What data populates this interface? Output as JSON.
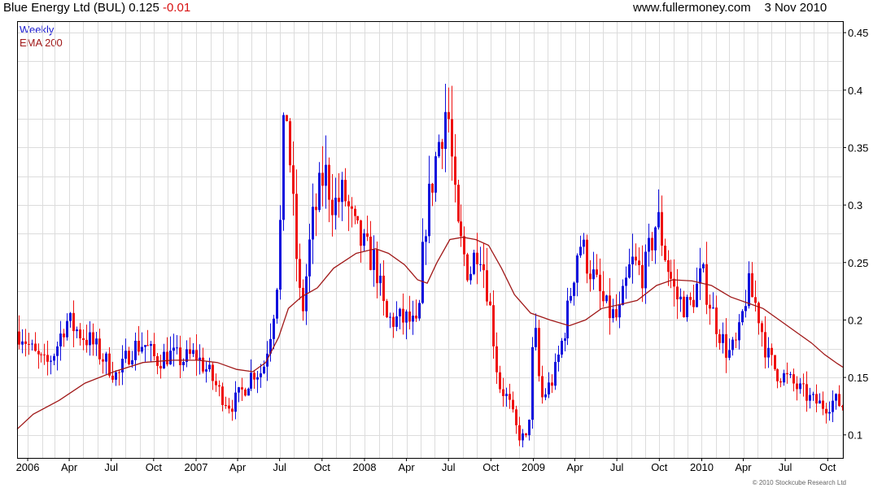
{
  "header": {
    "company": "Blue Energy Ltd (BUL)",
    "price": "0.125",
    "change": "-0.01",
    "site": "www.fullermoney.com",
    "date": "3 Nov 2010"
  },
  "legend": {
    "weekly_label": "Weekly",
    "ema_label": "EMA 200"
  },
  "copyright": "© 2010 Stockcube Research Ltd",
  "colors": {
    "up": "#1010dd",
    "down": "#ee1010",
    "ema": "#a01818",
    "grid": "#dcdcdc",
    "axis": "#000000"
  },
  "chart_data": {
    "type": "candlestick",
    "interval": "weekly",
    "ylim": [
      0.08,
      0.46
    ],
    "y_ticks": [
      "0.1",
      "0.15",
      "0.2",
      "0.25",
      "0.3",
      "0.35",
      "0.4",
      "0.45"
    ],
    "x_ticks": [
      "2006",
      "Apr",
      "Jul",
      "Oct",
      "2007",
      "Apr",
      "Jul",
      "Oct",
      "2008",
      "Apr",
      "Jul",
      "Oct",
      "2009",
      "Apr",
      "Jul",
      "Oct",
      "2010",
      "Apr",
      "Jul",
      "Oct"
    ],
    "grid": true,
    "x_start": "2005-12-09",
    "x_end": "2010-11-03",
    "close_path": [
      [
        "2005-12-16",
        0.19
      ],
      [
        "2006-01-13",
        0.17
      ],
      [
        "2006-02-10",
        0.16
      ],
      [
        "2006-03-03",
        0.175
      ],
      [
        "2006-03-24",
        0.2
      ],
      [
        "2006-04-21",
        0.19
      ],
      [
        "2006-05-19",
        0.18
      ],
      [
        "2006-06-16",
        0.165
      ],
      [
        "2006-07-14",
        0.15
      ],
      [
        "2006-08-11",
        0.175
      ],
      [
        "2006-09-08",
        0.18
      ],
      [
        "2006-10-06",
        0.165
      ],
      [
        "2006-11-03",
        0.17
      ],
      [
        "2006-12-01",
        0.165
      ],
      [
        "2006-12-29",
        0.17
      ],
      [
        "2007-01-26",
        0.155
      ],
      [
        "2007-02-23",
        0.135
      ],
      [
        "2007-03-16",
        0.125
      ],
      [
        "2007-04-13",
        0.14
      ],
      [
        "2007-05-04",
        0.155
      ],
      [
        "2007-05-25",
        0.155
      ],
      [
        "2007-06-15",
        0.2
      ],
      [
        "2007-06-29",
        0.25
      ],
      [
        "2007-07-13",
        0.4
      ],
      [
        "2007-08-03",
        0.27
      ],
      [
        "2007-08-17",
        0.2
      ],
      [
        "2007-09-07",
        0.28
      ],
      [
        "2007-10-05",
        0.33
      ],
      [
        "2007-10-26",
        0.3
      ],
      [
        "2007-11-16",
        0.31
      ],
      [
        "2007-12-07",
        0.28
      ],
      [
        "2008-01-04",
        0.26
      ],
      [
        "2008-01-25",
        0.25
      ],
      [
        "2008-02-15",
        0.2
      ],
      [
        "2008-03-14",
        0.2
      ],
      [
        "2008-04-04",
        0.2
      ],
      [
        "2008-04-25",
        0.19
      ],
      [
        "2008-05-09",
        0.28
      ],
      [
        "2008-06-06",
        0.35
      ],
      [
        "2008-06-27",
        0.39
      ],
      [
        "2008-07-18",
        0.28
      ],
      [
        "2008-08-15",
        0.24
      ],
      [
        "2008-09-05",
        0.27
      ],
      [
        "2008-09-26",
        0.22
      ],
      [
        "2008-10-17",
        0.145
      ],
      [
        "2008-11-07",
        0.13
      ],
      [
        "2008-11-28",
        0.1
      ],
      [
        "2008-12-19",
        0.095
      ],
      [
        "2009-01-02",
        0.2
      ],
      [
        "2009-01-16",
        0.13
      ],
      [
        "2009-02-13",
        0.15
      ],
      [
        "2009-03-13",
        0.2
      ],
      [
        "2009-04-10",
        0.27
      ],
      [
        "2009-05-08",
        0.24
      ],
      [
        "2009-06-05",
        0.21
      ],
      [
        "2009-07-03",
        0.2
      ],
      [
        "2009-07-31",
        0.25
      ],
      [
        "2009-08-28",
        0.24
      ],
      [
        "2009-09-25",
        0.29
      ],
      [
        "2009-10-16",
        0.25
      ],
      [
        "2009-11-06",
        0.22
      ],
      [
        "2009-12-04",
        0.21
      ],
      [
        "2010-01-01",
        0.24
      ],
      [
        "2010-01-29",
        0.2
      ],
      [
        "2010-02-26",
        0.17
      ],
      [
        "2010-03-19",
        0.18
      ],
      [
        "2010-04-09",
        0.23
      ],
      [
        "2010-04-30",
        0.21
      ],
      [
        "2010-05-21",
        0.17
      ],
      [
        "2010-06-11",
        0.155
      ],
      [
        "2010-07-02",
        0.15
      ],
      [
        "2010-07-30",
        0.14
      ],
      [
        "2010-08-27",
        0.13
      ],
      [
        "2010-09-24",
        0.125
      ],
      [
        "2010-10-15",
        0.13
      ],
      [
        "2010-11-03",
        0.125
      ]
    ],
    "ema200": [
      [
        "2005-12-09",
        0.105
      ],
      [
        "2006-01-13",
        0.118
      ],
      [
        "2006-03-10",
        0.13
      ],
      [
        "2006-05-05",
        0.145
      ],
      [
        "2006-07-07",
        0.155
      ],
      [
        "2006-09-08",
        0.163
      ],
      [
        "2006-11-10",
        0.165
      ],
      [
        "2007-01-05",
        0.165
      ],
      [
        "2007-02-16",
        0.163
      ],
      [
        "2007-03-30",
        0.157
      ],
      [
        "2007-05-04",
        0.155
      ],
      [
        "2007-06-01",
        0.163
      ],
      [
        "2007-06-29",
        0.185
      ],
      [
        "2007-07-20",
        0.21
      ],
      [
        "2007-08-17",
        0.22
      ],
      [
        "2007-09-21",
        0.228
      ],
      [
        "2007-10-26",
        0.245
      ],
      [
        "2007-12-14",
        0.258
      ],
      [
        "2008-01-25",
        0.262
      ],
      [
        "2008-02-22",
        0.258
      ],
      [
        "2008-03-28",
        0.248
      ],
      [
        "2008-04-25",
        0.235
      ],
      [
        "2008-05-16",
        0.232
      ],
      [
        "2008-06-06",
        0.25
      ],
      [
        "2008-07-04",
        0.27
      ],
      [
        "2008-08-01",
        0.272
      ],
      [
        "2008-08-29",
        0.27
      ],
      [
        "2008-09-26",
        0.265
      ],
      [
        "2008-10-24",
        0.245
      ],
      [
        "2008-11-21",
        0.222
      ],
      [
        "2008-12-26",
        0.206
      ],
      [
        "2009-02-06",
        0.2
      ],
      [
        "2009-03-20",
        0.195
      ],
      [
        "2009-04-24",
        0.2
      ],
      [
        "2009-05-29",
        0.21
      ],
      [
        "2009-07-03",
        0.213
      ],
      [
        "2009-08-14",
        0.217
      ],
      [
        "2009-09-25",
        0.23
      ],
      [
        "2009-10-30",
        0.235
      ],
      [
        "2009-12-11",
        0.234
      ],
      [
        "2010-01-22",
        0.23
      ],
      [
        "2010-03-05",
        0.22
      ],
      [
        "2010-04-16",
        0.214
      ],
      [
        "2010-05-14",
        0.21
      ],
      [
        "2010-06-18",
        0.2
      ],
      [
        "2010-07-23",
        0.19
      ],
      [
        "2010-08-27",
        0.18
      ],
      [
        "2010-09-24",
        0.17
      ],
      [
        "2010-10-22",
        0.162
      ],
      [
        "2010-11-03",
        0.159
      ]
    ]
  }
}
